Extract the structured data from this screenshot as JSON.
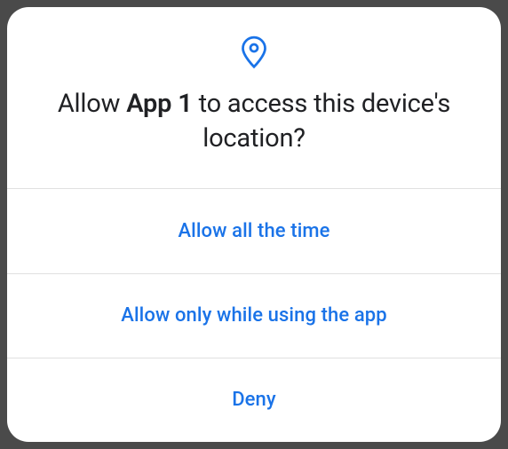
{
  "dialog": {
    "icon": "location-pin-icon",
    "title_prefix": "Allow ",
    "app_name": "App 1",
    "title_suffix": " to access this device's location?",
    "options": {
      "allow_always": "Allow all the time",
      "allow_while_using": "Allow only while using the app",
      "deny": "Deny"
    }
  },
  "colors": {
    "accent": "#1a73e8",
    "text": "#202124",
    "divider": "#e0e0e0"
  }
}
